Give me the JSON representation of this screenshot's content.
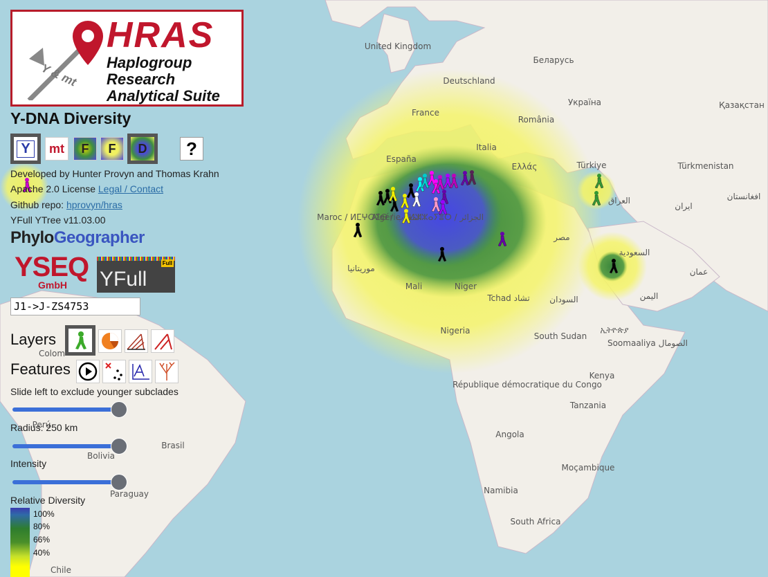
{
  "logo": {
    "title": "HRAS",
    "subtitle_lines": [
      "Haplogroup",
      "Research",
      "Analytical Suite"
    ],
    "tag": "Y & mt"
  },
  "page_title": "Y-DNA Diversity",
  "mode_buttons": [
    {
      "id": "y",
      "label": "Y",
      "selected": true
    },
    {
      "id": "mt",
      "label": "mt",
      "selected": false
    },
    {
      "id": "f1",
      "label": "F",
      "selected": false
    },
    {
      "id": "f2",
      "label": "F",
      "selected": false
    },
    {
      "id": "d",
      "label": "D",
      "selected": true
    },
    {
      "id": "help",
      "label": "?",
      "selected": false
    }
  ],
  "info": {
    "developed_by": "Developed by Hunter Provyn and Thomas Krahn",
    "license_prefix": "Apache 2.0 License",
    "legal_link": "Legal / Contact",
    "github_prefix": "Github repo:",
    "github_link": "hprovyn/hras",
    "ytree_version": "YFull YTree v11.03.00"
  },
  "sponsors": {
    "phylo": [
      "Phylo",
      "Geo",
      "grapher"
    ],
    "yseq_main": "YSEQ",
    "yseq_sub": "GmbH",
    "yfull": "YFull",
    "yfull_badge": "Full"
  },
  "search": {
    "value": "J1->J-ZS4753"
  },
  "layers": {
    "label": "Layers"
  },
  "features": {
    "label": "Features"
  },
  "sliders": {
    "subclades": {
      "label": "Slide left to exclude younger subclades",
      "value_fraction": 1.0
    },
    "radius": {
      "label": "Radius: 250 km",
      "value_fraction": 1.0
    },
    "intensity": {
      "label": "Intensity",
      "value_fraction": 1.0
    }
  },
  "legend": {
    "title": "Relative Diversity",
    "ticks": [
      "100%",
      "80%",
      "66%",
      "40%"
    ]
  },
  "map": {
    "labels": [
      "United Kingdom",
      "Беларусь",
      "Deutschland",
      "Україна",
      "Қазақстан",
      "France",
      "România",
      "España",
      "Italia",
      "Ελλάς",
      "Türkiye",
      "Türkmenistan",
      "العراق",
      "ایران",
      "افغانستان",
      "Maroc / ⵍⵎⵖⵔⵉⴱ / المغرب",
      "Algérie / ⵍⵣⵣⴰⵢⴻⵔ / الجزائر",
      "مصر",
      "موريتانيا",
      "Mali",
      "Niger",
      "Tchad تشاد",
      "السودان",
      "السعودية",
      "عمان",
      "اليمن",
      "Nigeria",
      "South Sudan",
      "ኢትዮጵያ",
      "Soomaaliya الصومال",
      "République démocratique du Congo",
      "Kenya",
      "Tanzania",
      "Angola",
      "Moçambique",
      "Namibia",
      "South Africa",
      "Brasil",
      "Bolivia",
      "Paraguay",
      "Perú",
      "Colom",
      "Chile"
    ],
    "colors": {
      "water": "#aad3df",
      "land": "#f2efe9",
      "heat_outer": "#f5f57a",
      "heat_mid": "#3f8f3f",
      "heat_core": "#4b4bd6"
    }
  }
}
